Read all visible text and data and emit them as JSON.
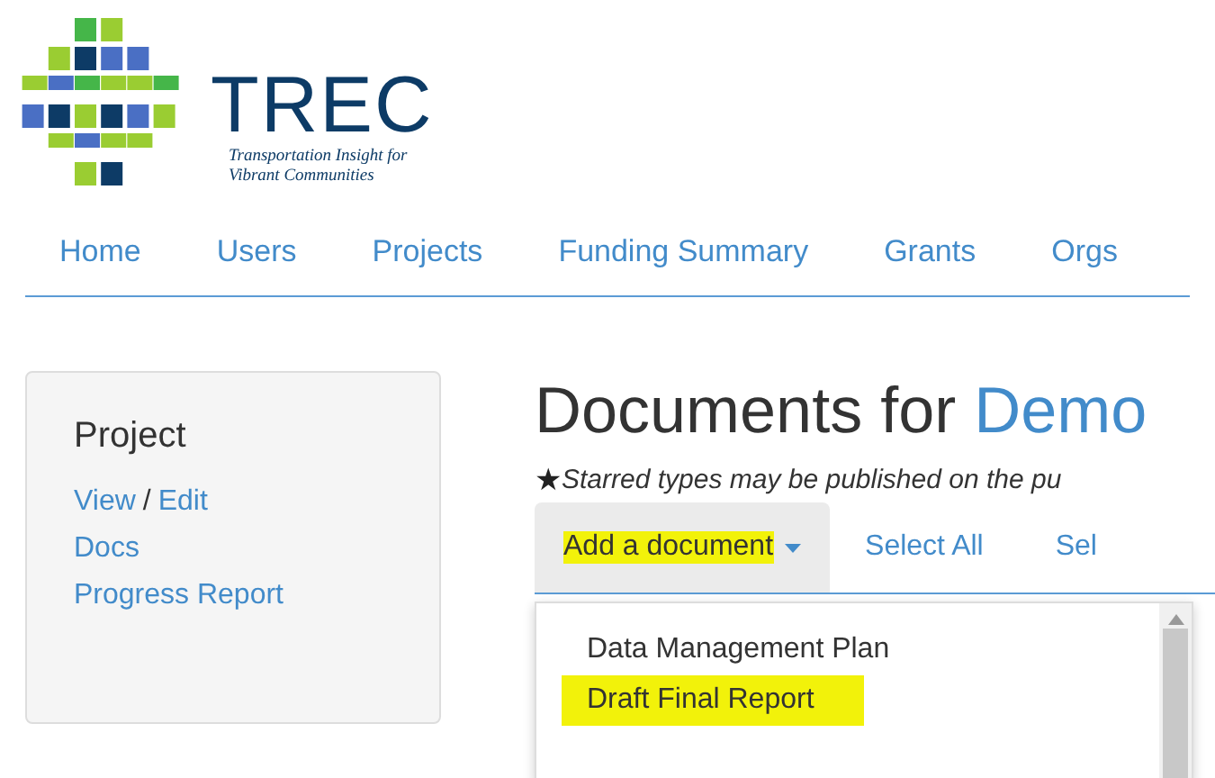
{
  "logo": {
    "name": "TREC",
    "tagline_lines": [
      "Transportation Insight for",
      "Vibrant Communities"
    ]
  },
  "nav": {
    "items": [
      {
        "label": "Home"
      },
      {
        "label": "Users"
      },
      {
        "label": "Projects"
      },
      {
        "label": "Funding Summary"
      },
      {
        "label": "Grants"
      },
      {
        "label": "Orgs"
      }
    ]
  },
  "sidebar": {
    "title": "Project",
    "links": [
      [
        "View",
        "Edit"
      ],
      [
        "Docs"
      ],
      [
        "Progress Report"
      ]
    ],
    "separator": "/"
  },
  "main": {
    "heading": "Documents for",
    "heading_link": "Demo",
    "note_star": "★",
    "note": "Starred types may be published on the pu",
    "toolbar": [
      {
        "kind": "dropdown",
        "label": "Add a document",
        "highlighted": true
      },
      {
        "kind": "link",
        "label": "Select All",
        "highlighted": false
      },
      {
        "kind": "link",
        "label": "Sel",
        "highlighted": false
      }
    ],
    "menu": [
      {
        "label": "Data Management Plan",
        "highlighted": false
      },
      {
        "label": "Draft Final Report",
        "highlighted": true
      }
    ]
  }
}
